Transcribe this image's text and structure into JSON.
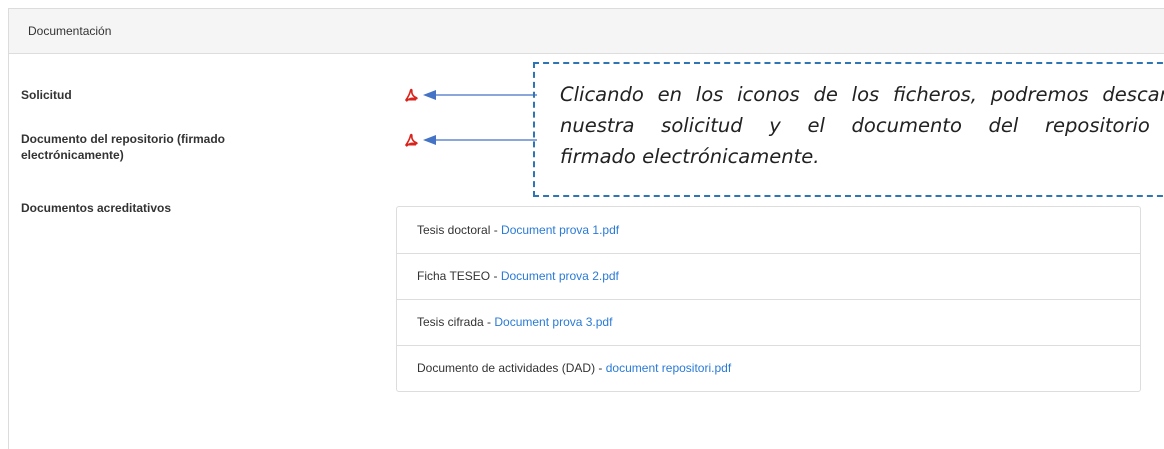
{
  "panel": {
    "title": "Documentación"
  },
  "fields": {
    "solicitud_label": "Solicitud",
    "repositorio_label_line1": "Documento del repositorio (firmado",
    "repositorio_label_line2": "electrónicamente)",
    "acreditativos_label": "Documentos acreditativos"
  },
  "icons": {
    "solicitud_icon": "pdf-icon",
    "repositorio_icon": "pdf-icon",
    "arrow": "arrow-left-icon"
  },
  "callout": {
    "line1": "Clicando en los iconos de los ficheros, podremos descargar",
    "line2": "nuestra solicitud y el documento del repositorio ya",
    "line3": "firmado electrónicamente.",
    "border_color": "#2e75b6"
  },
  "documents": [
    {
      "type": "Tesis doctoral",
      "separator": " - ",
      "file": "Document prova 1.pdf"
    },
    {
      "type": "Ficha TESEO",
      "separator": " - ",
      "file": "Document prova 2.pdf"
    },
    {
      "type": "Tesis cifrada",
      "separator": " - ",
      "file": "Document prova 3.pdf"
    },
    {
      "type": "Documento de actividades (DAD)",
      "separator": " - ",
      "file": "document repositori.pdf"
    }
  ],
  "colors": {
    "link": "#2a7ad6",
    "pdf_red": "#d9231b",
    "arrow_blue": "#4472c4"
  }
}
